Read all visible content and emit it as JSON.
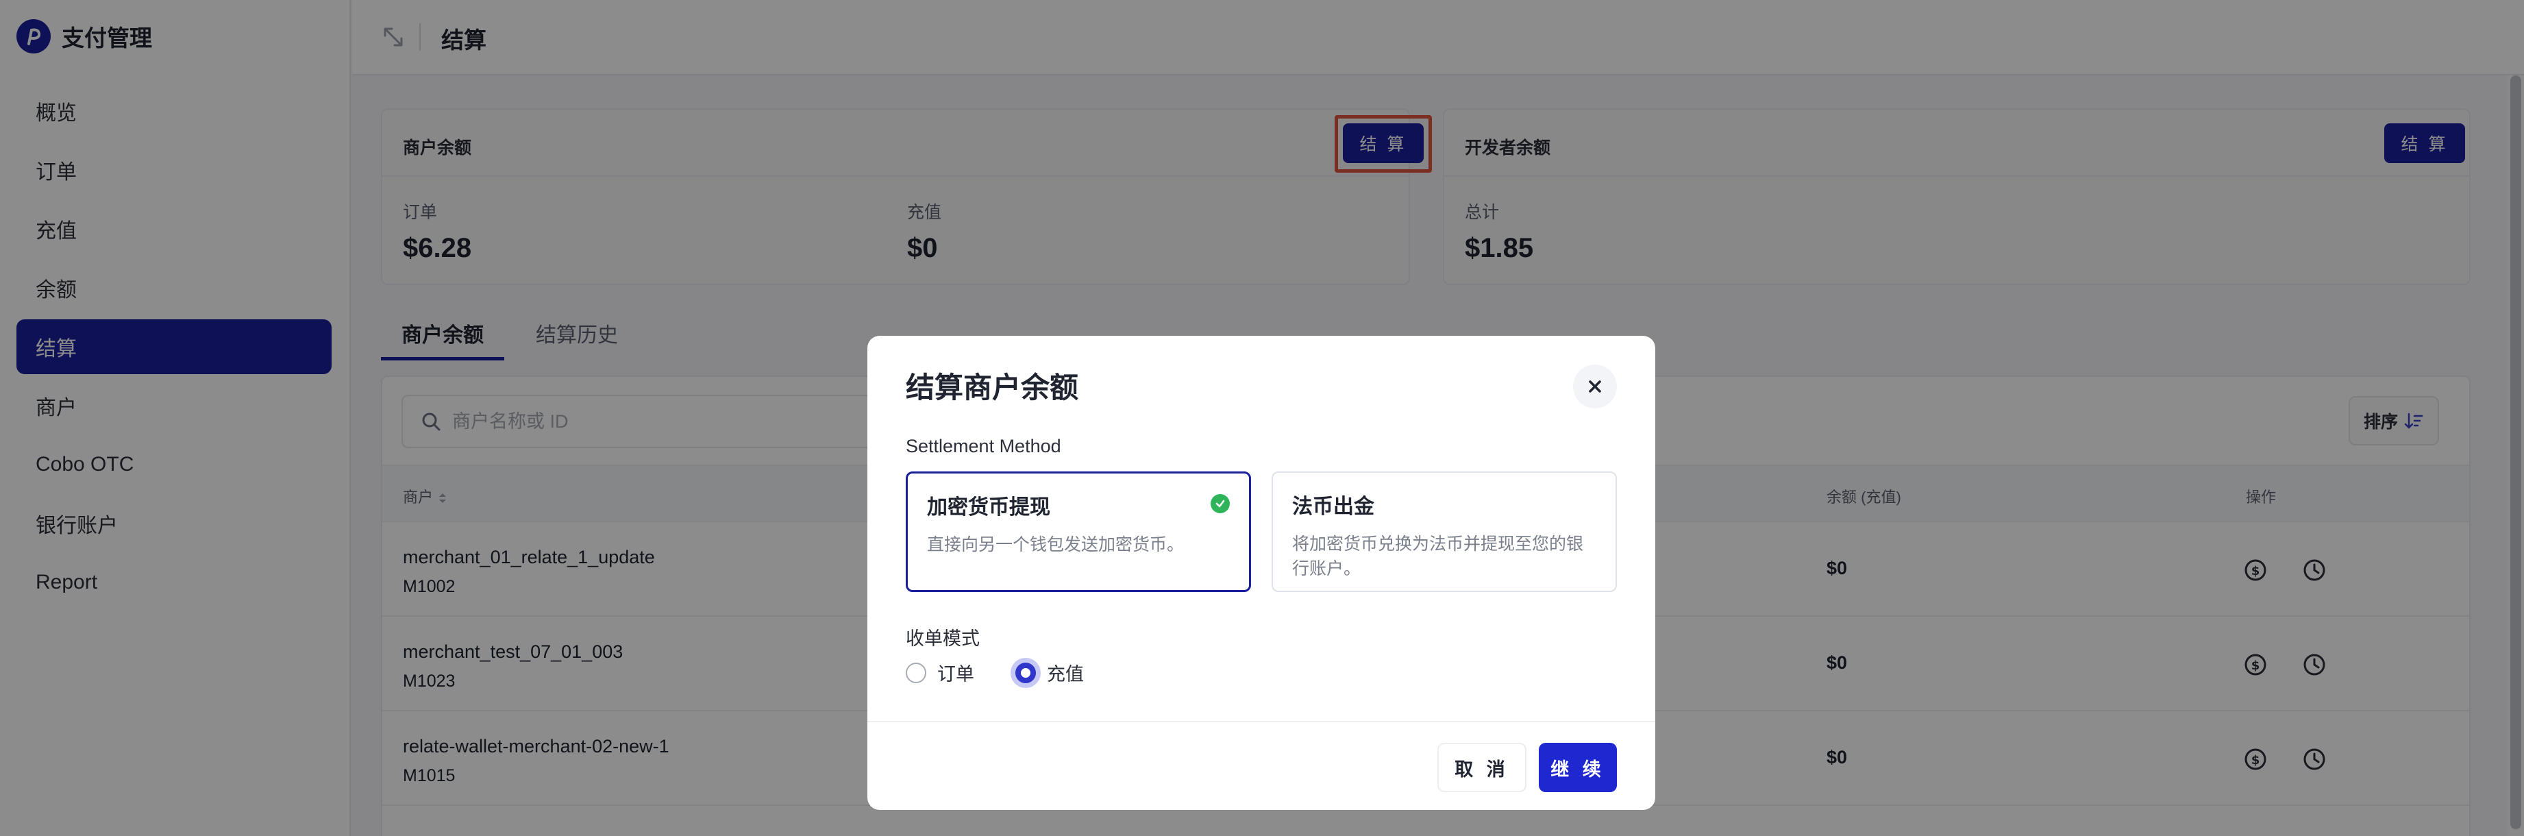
{
  "app": {
    "title": "支付管理"
  },
  "sidebar": {
    "items": [
      {
        "label": "概览"
      },
      {
        "label": "订单"
      },
      {
        "label": "充值"
      },
      {
        "label": "余额"
      },
      {
        "label": "结算",
        "active": true
      },
      {
        "label": "商户"
      },
      {
        "label": "Cobo OTC"
      },
      {
        "label": "银行账户"
      },
      {
        "label": "Report"
      }
    ]
  },
  "header": {
    "title": "结算"
  },
  "merchant_card": {
    "title": "商户余额",
    "button": "结 算",
    "stats": [
      {
        "label": "订单",
        "value": "$6.28"
      },
      {
        "label": "充值",
        "value": "$0"
      }
    ]
  },
  "developer_card": {
    "title": "开发者余额",
    "button": "结 算",
    "stats": [
      {
        "label": "总计",
        "value": "$1.85"
      }
    ]
  },
  "tabs": [
    {
      "label": "商户余额",
      "active": true
    },
    {
      "label": "结算历史"
    }
  ],
  "table": {
    "search_placeholder": "商户名称或 ID",
    "sort_label": "排序",
    "headers": {
      "merchant": "商户",
      "balance": "余额 (充值)",
      "actions": "操作"
    },
    "rows": [
      {
        "name": "merchant_01_relate_1_update",
        "id": "M1002",
        "balance": "$0"
      },
      {
        "name": "merchant_test_07_01_003",
        "id": "M1023",
        "balance": "$0"
      },
      {
        "name": "relate-wallet-merchant-02-new-1",
        "id": "M1015",
        "balance": "$0"
      }
    ]
  },
  "modal": {
    "title": "结算商户余额",
    "method_label": "Settlement Method",
    "options": [
      {
        "title": "加密货币提现",
        "desc": "直接向另一个钱包发送加密货币。",
        "selected": true
      },
      {
        "title": "法币出金",
        "desc": "将加密货币兑换为法币并提现至您的银行账户。",
        "selected": false
      }
    ],
    "mode_label": "收单模式",
    "modes": [
      {
        "label": "订单",
        "checked": false
      },
      {
        "label": "充值",
        "checked": true
      }
    ],
    "cancel": "取 消",
    "continue": "继 续"
  },
  "colors": {
    "primary": "#1a1f9c",
    "accent": "#1f27d1",
    "success": "#2fb45a",
    "highlight": "#e0553f"
  }
}
